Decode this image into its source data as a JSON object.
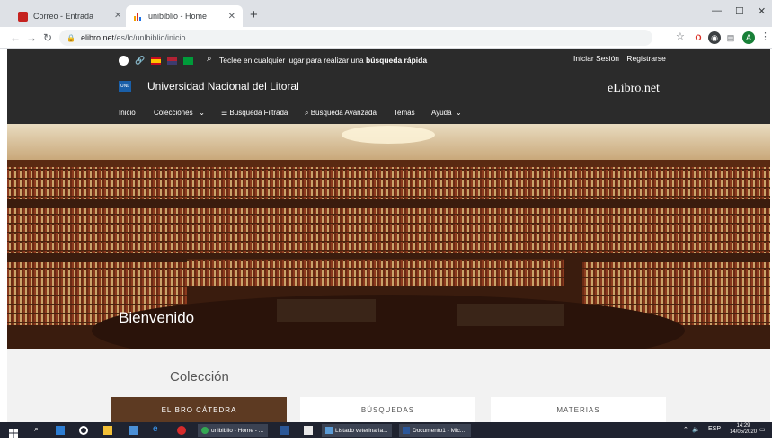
{
  "browser": {
    "tabs": [
      {
        "label": "Correo - Entrada",
        "active": false
      },
      {
        "label": "unibiblio - Home",
        "active": true
      }
    ],
    "url_host": "elibro.net",
    "url_path": "/es/lc/unlbiblio/inicio",
    "window_controls": [
      "—",
      "☐",
      "✕"
    ]
  },
  "site": {
    "search_hint": "Teclee en cualquier lugar para realizar una",
    "search_hint_bold": "búsqueda rápida",
    "login": "Iniciar Sesión",
    "register": "Registrarse",
    "logo_text": "UNL",
    "university": "Universidad Nacional del Litoral",
    "brand": "eLibro.net",
    "menu": {
      "inicio": "Inicio",
      "colecciones": "Colecciones",
      "busqueda_filtrada": "Búsqueda Filtrada",
      "busqueda_avanzada": "Búsqueda Avanzada",
      "temas": "Temas",
      "ayuda": "Ayuda"
    },
    "hero_title": "Bienvenido",
    "collection_title": "Colección",
    "cards": [
      "ELIBRO CÁTEDRA",
      "BÚSQUEDAS",
      "MATERIAS"
    ]
  },
  "taskbar": {
    "apps": [
      "unlbiblio - Home - ...",
      "Listado veterinaria...",
      "Documento1 - Mic..."
    ],
    "lang": "ESP",
    "time": "14:29",
    "date": "14/05/2020"
  },
  "colors": {
    "header_bg": "#2b2b2b",
    "brand_blue": "#1a5fa8",
    "taskbar_bg": "#1f2330"
  }
}
